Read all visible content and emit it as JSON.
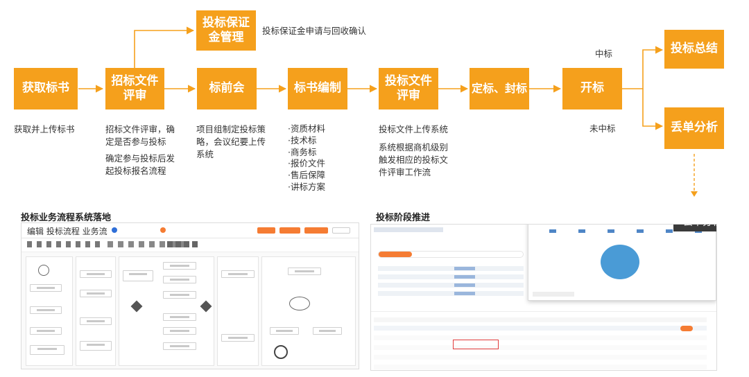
{
  "flow": {
    "steps": {
      "get_tender": "获取标书",
      "tender_review": "招标文件\n评审",
      "pre_bid": "标前会",
      "bid_prep": "标书编制",
      "bid_file_review": "投标文件\n评审",
      "pricing_seal": "定标、封标",
      "opening": "开标",
      "deposit": "投标保证\n金管理",
      "bid_summary": "投标总结",
      "loss_analysis": "丢单分析"
    },
    "descriptions": {
      "get_tender": "获取并上传标书",
      "tender_review_1": "招标文件评审，确\n定是否参与投标",
      "tender_review_2": "确定参与投标后发\n起投标报名流程",
      "pre_bid": "项目组制定投标策\n略，会议纪要上传\n系统",
      "bid_prep": "·资质材料\n·技术标\n·商务标\n·报价文件\n·售后保障\n·讲标方案",
      "bid_file_review_1": "投标文件上传系统",
      "bid_file_review_2": "系统根据商机级别\n触发相应的投标文\n件评审工作流",
      "deposit": "投标保证金申请与回收确认"
    },
    "outcomes": {
      "win": "中标",
      "lose": "未中标"
    },
    "colors": {
      "box": "#f5a01c",
      "arrow": "#f5a01c"
    }
  },
  "screens": {
    "left_title": "投标业务流程系统落地",
    "left_screen_heading": "编辑 投标流程 业务流",
    "right_title": "投标阶段推进",
    "right_overlay": "丢单分析"
  }
}
